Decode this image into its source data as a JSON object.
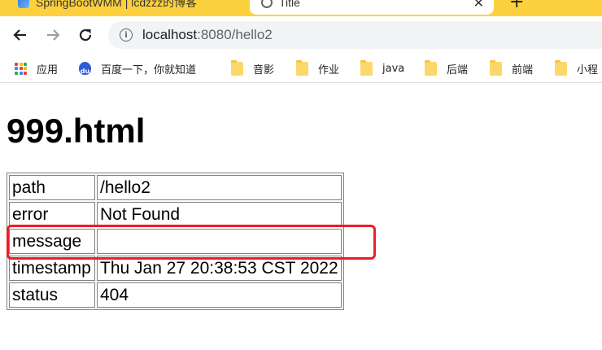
{
  "browser": {
    "tabs": [
      {
        "title": "SpringBootWMM | lcdzzz的博客",
        "active": false
      },
      {
        "title": "Title",
        "active": true
      }
    ],
    "new_tab_glyph": "+",
    "close_glyph": "✕",
    "address": {
      "host": "localhost",
      "rest": ":8080/hello2"
    },
    "bookmarks": [
      {
        "label": "应用",
        "icon": "apps-icon"
      },
      {
        "label": "百度一下，你就知道",
        "icon": "baidu-paw-icon"
      },
      {
        "label": "音影",
        "icon": "folder-icon"
      },
      {
        "label": "作业",
        "icon": "folder-icon"
      },
      {
        "label": "java",
        "icon": "folder-icon"
      },
      {
        "label": "后端",
        "icon": "folder-icon"
      },
      {
        "label": "前端",
        "icon": "folder-icon"
      },
      {
        "label": "小程",
        "icon": "folder-icon"
      }
    ],
    "colors": {
      "tab_strip": "#fcd13d",
      "folder": "#fbd86b",
      "highlight": "#e8202a"
    }
  },
  "page": {
    "heading": "999.html",
    "rows": [
      {
        "key": "path",
        "value": "/hello2"
      },
      {
        "key": "error",
        "value": "Not Found"
      },
      {
        "key": "message",
        "value": ""
      },
      {
        "key": "timestamp",
        "value": "Thu Jan 27 20:38:53 CST 2022"
      },
      {
        "key": "status",
        "value": "404"
      }
    ]
  }
}
